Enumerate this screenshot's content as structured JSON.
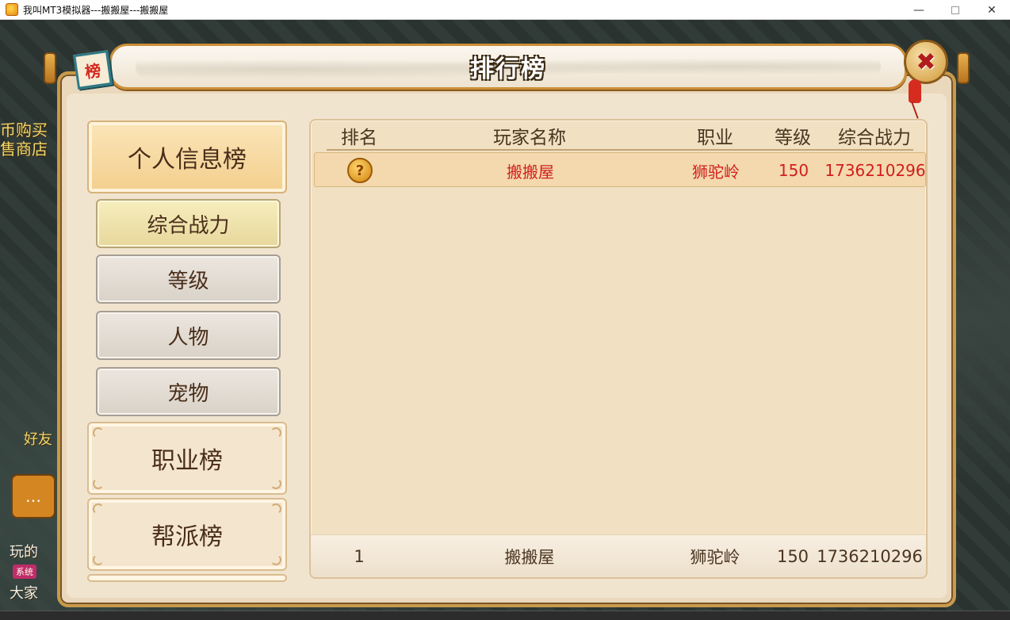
{
  "window": {
    "title": "我叫MT3模拟器---搬搬屋---搬搬屋",
    "minimize": "—",
    "close": "✕"
  },
  "background": {
    "text1": "币购买",
    "text2": "售商店",
    "friend": "好友",
    "chat": "…",
    "sys_badge": "系统",
    "text3": "玩的",
    "text4": "大家"
  },
  "panel": {
    "title": "排行榜",
    "badge_char": "榜",
    "close_glyph": "✖"
  },
  "nav": {
    "main_personal": "个人信息榜",
    "sub": [
      "综合战力",
      "等级",
      "人物",
      "宠物"
    ],
    "main_job": "职业榜",
    "main_guild": "帮派榜"
  },
  "table": {
    "columns": [
      "排名",
      "玩家名称",
      "职业",
      "等级",
      "综合战力"
    ],
    "rows": [
      {
        "rank_icon": "?",
        "name": "搬搬屋",
        "job": "狮驼岭",
        "level": "150",
        "power": "1736210296"
      }
    ],
    "self": {
      "rank": "1",
      "name": "搬搬屋",
      "job": "狮驼岭",
      "level": "150",
      "power": "1736210296"
    }
  }
}
